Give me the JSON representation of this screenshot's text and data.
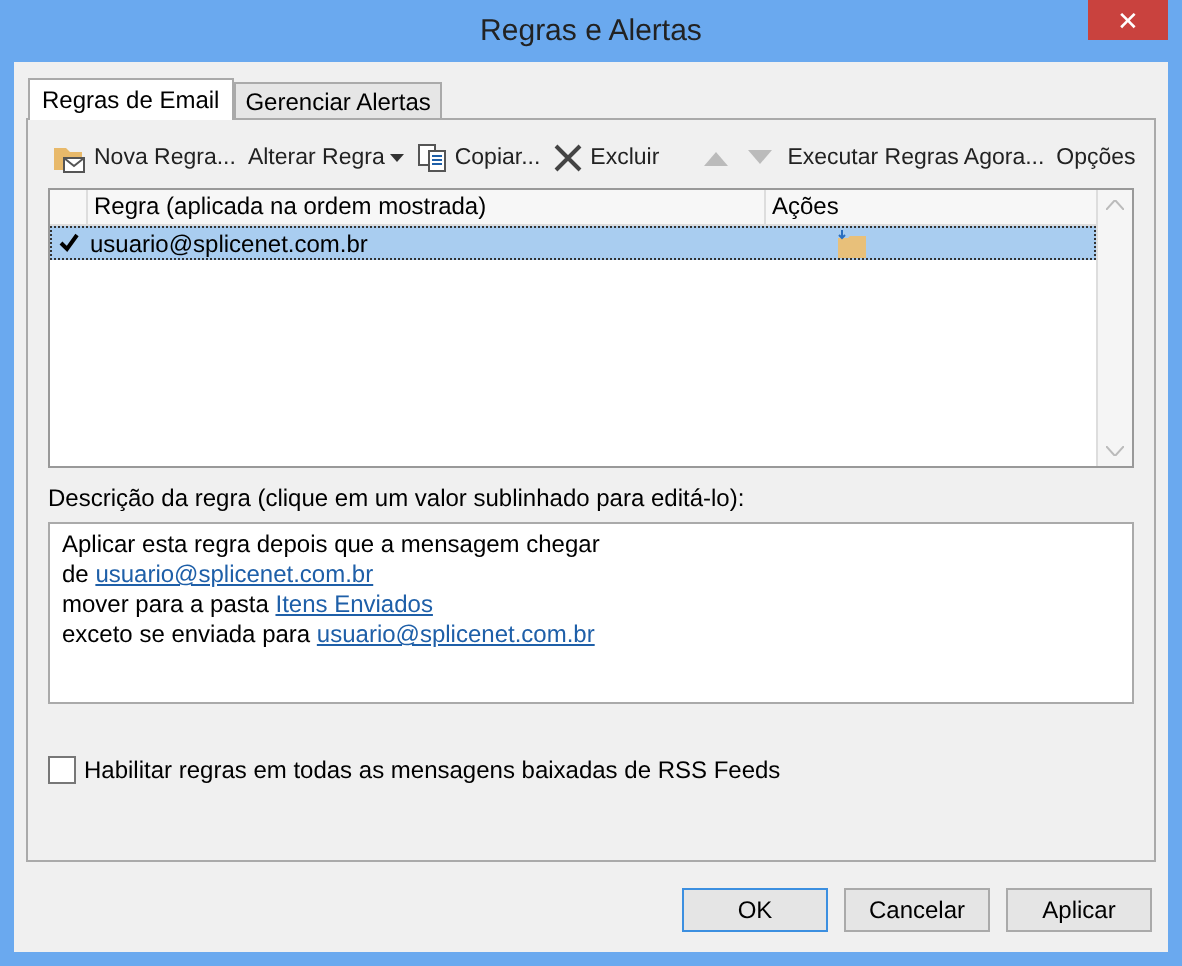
{
  "window": {
    "title": "Regras e Alertas",
    "close": "✕"
  },
  "tabs": [
    {
      "label": "Regras de Email",
      "selected": true
    },
    {
      "label": "Gerenciar Alertas",
      "selected": false
    }
  ],
  "toolbar": [
    {
      "kind": "new",
      "label": "Nova Regra...",
      "disabled": false
    },
    {
      "kind": "change",
      "label": "Alterar Regra",
      "disabled": false
    },
    {
      "kind": "copy",
      "label": "Copiar...",
      "disabled": false
    },
    {
      "kind": "delete",
      "label": "Excluir",
      "disabled": false
    },
    {
      "kind": "up",
      "disabled": true
    },
    {
      "kind": "down",
      "disabled": true
    },
    {
      "kind": "run",
      "label": "Executar Regras Agora...",
      "disabled": false
    },
    {
      "kind": "options",
      "label": "Opções",
      "disabled": false
    }
  ],
  "rules_table": {
    "columns": [
      "Regra (aplicada na ordem mostrada)",
      "Ações"
    ],
    "rows": [
      {
        "name": "usuario@splicenet.com.br",
        "checked": true,
        "selected": true
      }
    ]
  },
  "description": {
    "label": "Descrição da regra (clique em um valor sublinhado para editá-lo):",
    "lines": [
      {
        "text": "Aplicar esta regra depois que a mensagem chegar"
      },
      {
        "text": "de",
        "link": "usuario@splicenet.com.br"
      },
      {
        "text": "mover para a pasta",
        "link": "Itens Enviados"
      },
      {
        "text": "exceto se enviada para",
        "link": "usuario@splicenet.com.br"
      }
    ]
  },
  "rss_option": {
    "label": "Habilitar regras em todas as mensagens baixadas de RSS Feeds",
    "checked": false
  },
  "buttons": [
    {
      "label": "OK",
      "default": true
    },
    {
      "label": "Cancelar",
      "default": false
    },
    {
      "label": "Aplicar",
      "default": false
    }
  ]
}
